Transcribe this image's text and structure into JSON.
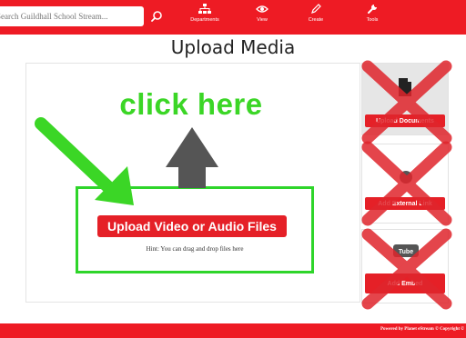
{
  "search": {
    "placeholder": "Search Guildhall School Stream..."
  },
  "nav": {
    "items": [
      {
        "label": "Departments",
        "icon": "sitemap-icon"
      },
      {
        "label": "View",
        "icon": "eye-icon"
      },
      {
        "label": "Create",
        "icon": "pencil-icon"
      },
      {
        "label": "Tools",
        "icon": "wrench-icon"
      }
    ]
  },
  "page": {
    "title": "Upload Media"
  },
  "annotation": {
    "text": "click here",
    "color": "#3bd626"
  },
  "upload": {
    "button_label": "Upload Video or Audio Files",
    "hint": "Hint: You can drag and drop files here"
  },
  "side_cards": [
    {
      "label": "Upload Documents",
      "crossed_out": true
    },
    {
      "label": "Add External Link",
      "crossed_out": true
    },
    {
      "label": "Add Embed",
      "crossed_out": true
    }
  ],
  "footer": {
    "text": "Powered by Planet eStream © Copyright ©"
  },
  "colors": {
    "brand_red": "#ee1b24",
    "button_red": "#e52027",
    "highlight_green": "#2ed52a",
    "cross_red": "#e0252c",
    "arrow_gray": "#555555"
  }
}
